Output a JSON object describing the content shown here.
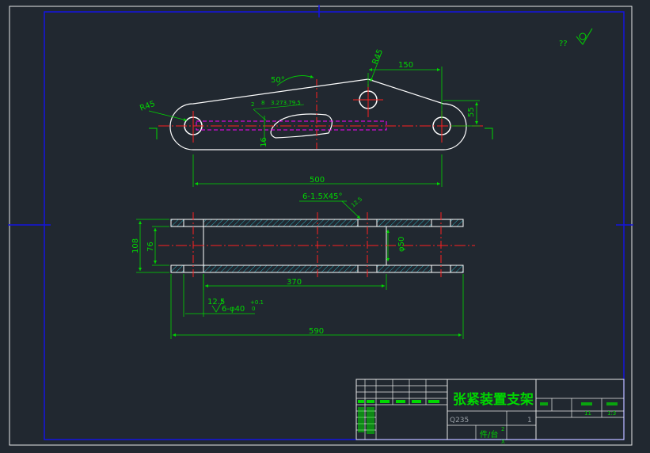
{
  "drawing": {
    "title": "张紧装置支架",
    "material": "Q235",
    "qty_label": "件/台",
    "qty_value": "2",
    "qty_mark": "X",
    "sheet_value": "1",
    "corner_roughness": "??",
    "scale_cells": [
      "11",
      "1:3"
    ]
  },
  "top_view": {
    "dim_150": "150",
    "dim_r45_top": "R45",
    "dim_r45_left": "R45",
    "dim_50deg": "50°",
    "dim_55": "55",
    "dim_500": "500",
    "dim_16": "16",
    "dim_slot": "2",
    "dim_slot_small": "8",
    "dim_slot_note": "3.273.79.5"
  },
  "side_view": {
    "chamfer": "6-1.5X45°",
    "roughness_chamfer": "12.5",
    "dim_108": "108",
    "dim_76": "76",
    "dim_phi50": "φ50",
    "dim_370": "370",
    "roughness_bore": "12.5",
    "bore_note": "6-φ40",
    "bore_tol_upper": "+0.1",
    "bore_tol_lower": "0",
    "dim_590": "590"
  },
  "colors": {
    "background": "#212830",
    "frame": "#1414e0",
    "outline": "#ffffff",
    "dimension": "#00d800",
    "centerline": "#ff2020",
    "hidden": "#ff00ff",
    "hatch": "#2aa8b8"
  }
}
